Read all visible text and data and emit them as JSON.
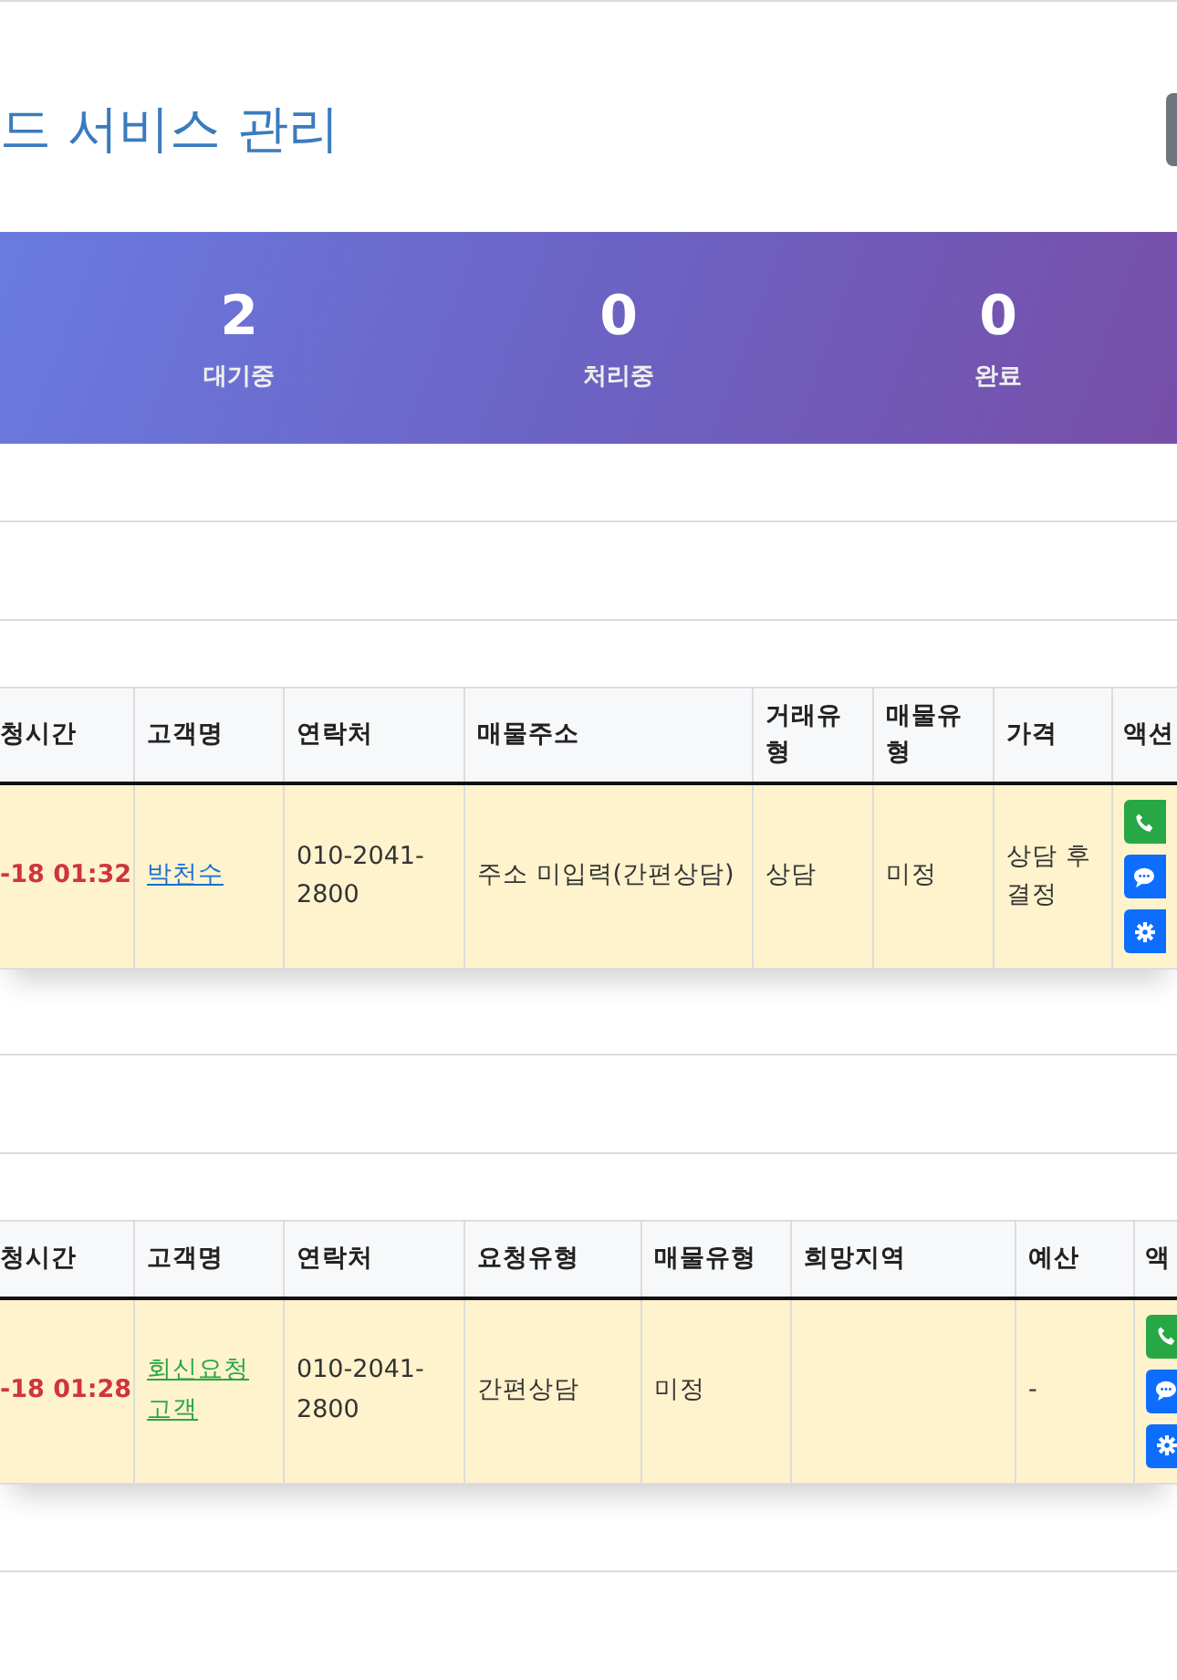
{
  "page_title": "드 서비스 관리",
  "stats": [
    {
      "value": "2",
      "label": "대기중"
    },
    {
      "value": "0",
      "label": "처리중"
    },
    {
      "value": "0",
      "label": "완료"
    }
  ],
  "tables": [
    {
      "columns": [
        "청시간",
        "고객명",
        "연락처",
        "매물주소",
        "거래유형",
        "매물유형",
        "가격",
        "액션"
      ],
      "rows": [
        {
          "cells": [
            {
              "kind": "time",
              "text": "-18 01:32"
            },
            {
              "kind": "link",
              "text": "박천수",
              "color": "#1a6fd4"
            },
            {
              "kind": "text",
              "text": "010-2041-2800"
            },
            {
              "kind": "text",
              "text": "주소 미입력(간편상담)"
            },
            {
              "kind": "text",
              "text": "상담"
            },
            {
              "kind": "text",
              "text": "미정"
            },
            {
              "kind": "text",
              "text": "상담 후 결정"
            }
          ],
          "actions": [
            {
              "kind": "phone"
            },
            {
              "kind": "sms"
            },
            {
              "kind": "settings"
            }
          ]
        }
      ]
    },
    {
      "columns": [
        "청시간",
        "고객명",
        "연락처",
        "요청유형",
        "매물유형",
        "희망지역",
        "예산",
        "액"
      ],
      "rows": [
        {
          "cells": [
            {
              "kind": "time",
              "text": "-18 01:28"
            },
            {
              "kind": "link",
              "text": "회신요청 고객",
              "color": "#28a745"
            },
            {
              "kind": "text",
              "text": "010-2041-2800"
            },
            {
              "kind": "text",
              "text": "간편상담"
            },
            {
              "kind": "text",
              "text": "미정"
            },
            null,
            {
              "kind": "text",
              "text": "-"
            }
          ],
          "actions": [
            {
              "kind": "phone"
            },
            {
              "kind": "sms"
            },
            {
              "kind": "settings"
            }
          ]
        }
      ]
    }
  ]
}
